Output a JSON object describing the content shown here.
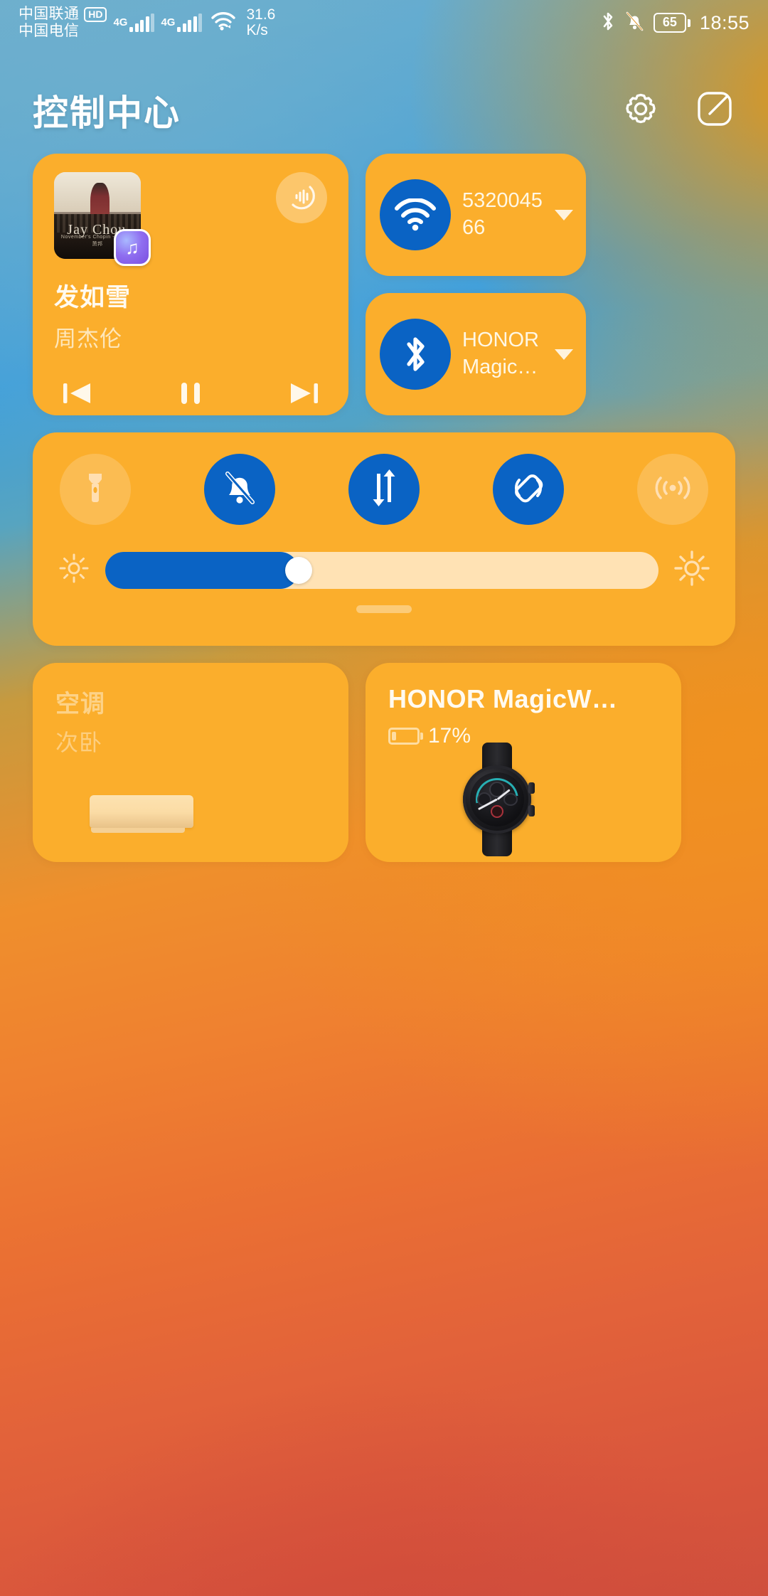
{
  "statusbar": {
    "carrier_primary": "中国联通",
    "hd_badge": "HD",
    "carrier_secondary": "中国电信",
    "net_gen_1": "4G",
    "net_gen_2": "4G",
    "speed_value": "31.6",
    "speed_unit": "K/s",
    "battery_level": "65",
    "clock": "18:55",
    "icons": {
      "wifi": "wifi-icon",
      "bluetooth": "bluetooth-icon",
      "silent": "bell-muted-icon",
      "battery": "battery-icon"
    }
  },
  "header": {
    "title": "控制中心",
    "settings_icon": "gear-icon",
    "edit_icon": "edit-icon"
  },
  "music": {
    "title": "发如雪",
    "artist": "周杰伦",
    "album_art_text": "Jay Chou",
    "album_art_subtext": "November's Chopin  十一月的萧邦",
    "app_badge_icon": "music-note-icon",
    "cast_icon": "audio-output-icon",
    "prev_icon": "previous-track-icon",
    "play_pause_icon": "pause-icon",
    "next_icon": "next-track-icon"
  },
  "connectivity": [
    {
      "name": "wifi",
      "icon": "wifi-icon",
      "label": "532004566",
      "state": "on",
      "caret": "chevron-down-icon"
    },
    {
      "name": "bluetooth",
      "icon": "bluetooth-icon",
      "label": "HONOR Magic…",
      "state": "on",
      "caret": "chevron-down-icon"
    }
  ],
  "toggles": [
    {
      "name": "flashlight",
      "icon": "flashlight-icon",
      "state": "off"
    },
    {
      "name": "silent-mode",
      "icon": "bell-muted-icon",
      "state": "on"
    },
    {
      "name": "mobile-data",
      "icon": "mobile-data-icon",
      "state": "on"
    },
    {
      "name": "auto-rotate",
      "icon": "screen-rotate-lock-icon",
      "state": "on"
    },
    {
      "name": "hotspot",
      "icon": "hotspot-icon",
      "state": "off"
    }
  ],
  "brightness": {
    "value_percent": 35,
    "low_icon": "brightness-low-icon",
    "high_icon": "brightness-high-icon"
  },
  "devices": [
    {
      "name": "air-conditioner",
      "title": "空调",
      "subtitle": "次卧",
      "state": "offline",
      "image": "air-conditioner-image"
    },
    {
      "name": "honor-magicwatch",
      "title": "HONOR MagicW…",
      "battery": "17%",
      "state": "connected",
      "image": "smartwatch-image"
    }
  ],
  "colors": {
    "card": "#fbae2c",
    "accent_on": "#0a63c4",
    "text_primary": "#fffaf0",
    "slider_track": "#ffe2b4"
  }
}
